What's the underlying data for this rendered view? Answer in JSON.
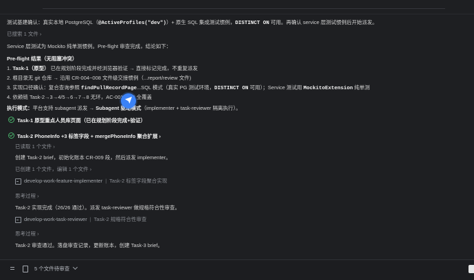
{
  "chat": {
    "line0": {
      "prefix": "测试基建确认：真实本地 PostgreSQL（",
      "code": "@ActiveProfiles(\"dev\")",
      "suffix1": "）+ 原生 SQL 集成测试惯例，",
      "code2": "DISTINCT ON",
      "suffix2": " 可用。再确认 service 层测试惯例后开始派发。"
    },
    "searched": "已搜索 1 文件 ›",
    "service_line": "Service 层测试为 Mockito 纯单测惯例。Pre-flight 审查完成，结论如下：",
    "preflight_title": "Pre-flight 结果（无阻塞冲突）",
    "items": [
      {
        "num": "1.",
        "a": "Task-1（原型）",
        "b": "已在规划阶段完成并经浏览器验证 → 直接标记完成，不重复派发"
      },
      {
        "num": "2.",
        "a": "根目录无 git 仓库 → 沿用 CR-004~008 文件级交接惯例（",
        "b": "...report/review 文件)"
      },
      {
        "num": "3.",
        "a": "实现口径确认：复合查询参照 ",
        "code": "findPullRecordPage",
        "b": "...SQL 模式（真实 PG 测试环境，",
        "code2": "DISTINCT ON",
        "c": " 可用）；Service 测试用 ",
        "code3": "MockitoExtension",
        "d": " 纯单测"
      },
      {
        "num": "4.",
        "a": "依赖链 Task-2→3→4/5→6→7→8 无环，AC-001~009 全覆盖"
      }
    ],
    "exec_line": {
      "a": "执行模式：",
      "b": "平台支持 subagent 派发 → ",
      "c": "Subagent 驱动模式",
      "d": "（implementer + task-reviewer 隔离执行）。"
    },
    "task1": "Task-1 原型重点人员库页面（已在规划阶段完成+验证）",
    "task2": "Task-2 PhoneInfo +3 标签字段 + mergePhoneInfo 聚合扩展 ›",
    "read_one": "已读取 1 个文件 ›",
    "create_line": "创建 Task-2 brief，初始化账本 CR-009 段，然后派发 implementer。",
    "created": "已创建 1 个文件，编辑 1 个文件 ›",
    "agent1": {
      "name": "develop-work-feature-implementer",
      "desc": "Task-2 标签字段聚合实现"
    },
    "thinking1": "思考过程 ›",
    "done_line": "Task-2 实现完成（26/26 通过）。派发 task-reviewer 做规格符合性审查。",
    "agent2": {
      "name": "develop-work-task-reviewer",
      "desc": "Task-2 规格符合性审查"
    },
    "thinking2": "思考过程 ›",
    "final_line": "Task-2 审查通过。落盘审查记录，更新账本，创建 Task-3 brief。"
  },
  "bottom": {
    "selector": "5 个文件待审查"
  },
  "colors": {
    "bg": "#1e1f22",
    "accent": "#3b82f6",
    "success": "#49b26b"
  }
}
